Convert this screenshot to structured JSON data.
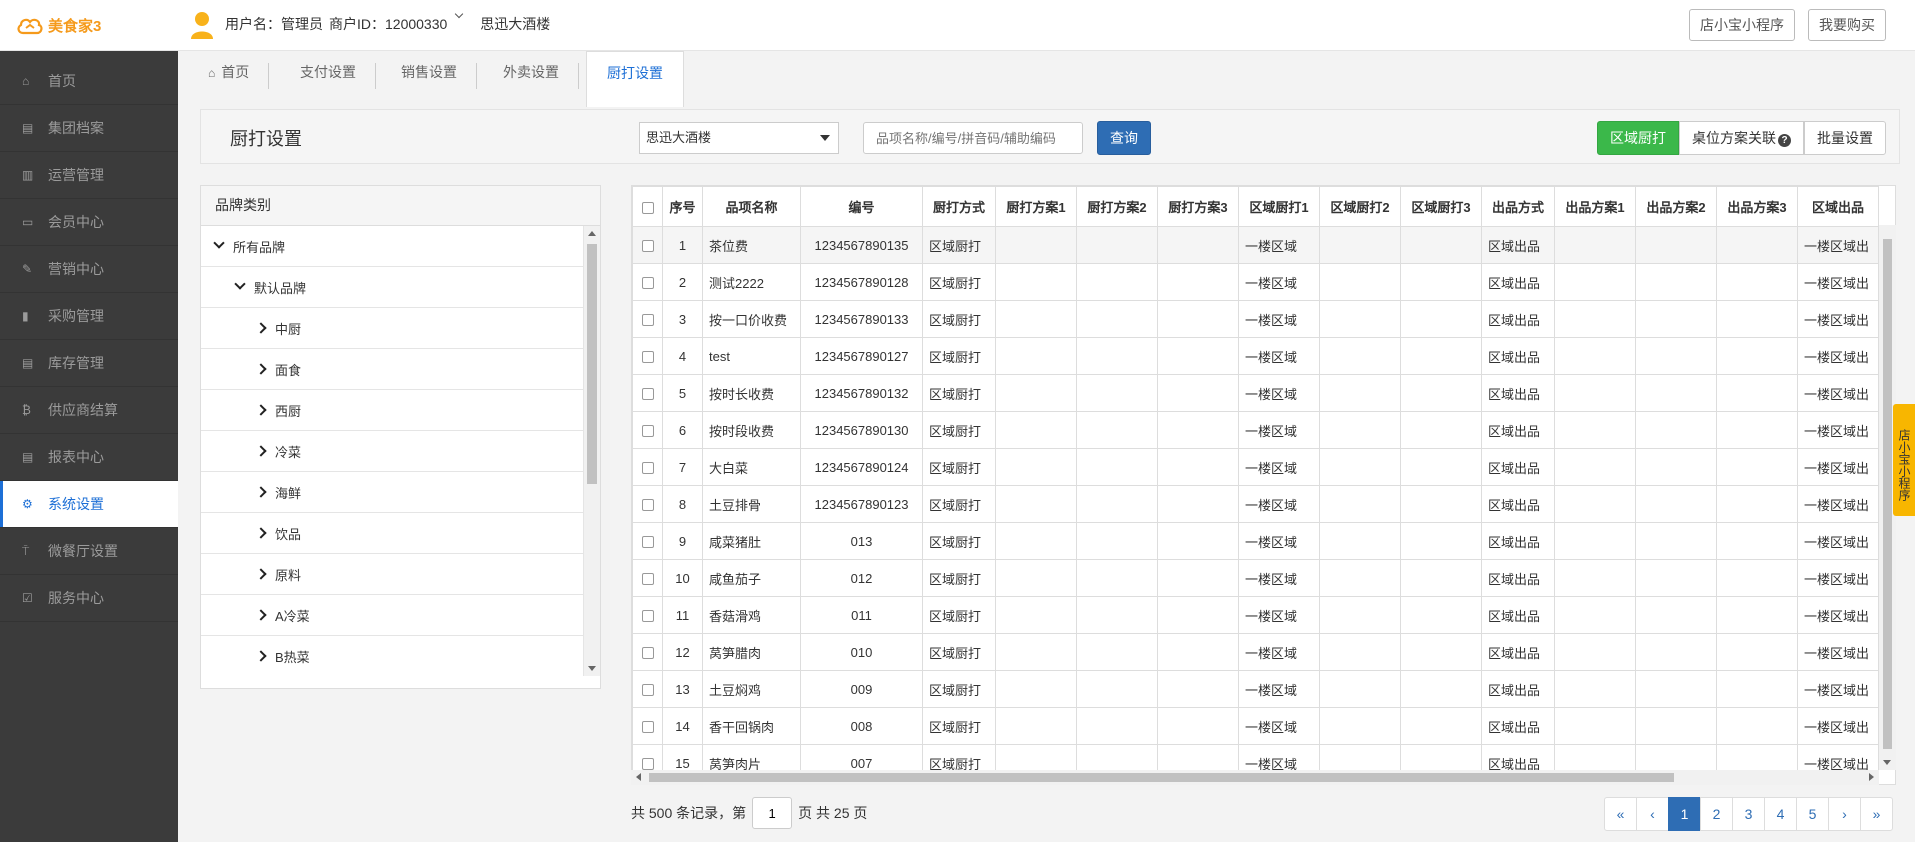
{
  "app": {
    "logo_text": "美食家3",
    "brand_color": "#f59a1b"
  },
  "header": {
    "user_label": "用户名：管理员",
    "merchant_label": "商户ID：12000330",
    "store_name": "思迅大酒楼",
    "btn_mini": "店小宝小程序",
    "btn_buy": "我要购买"
  },
  "sidebar": {
    "items": [
      {
        "label": "首页",
        "icon": "home-icon"
      },
      {
        "label": "集团档案",
        "icon": "file-icon"
      },
      {
        "label": "运营管理",
        "icon": "bar-chart-icon"
      },
      {
        "label": "会员中心",
        "icon": "id-card-icon"
      },
      {
        "label": "营销中心",
        "icon": "edit-icon"
      },
      {
        "label": "采购管理",
        "icon": "book-icon"
      },
      {
        "label": "库存管理",
        "icon": "file-icon"
      },
      {
        "label": "供应商结算",
        "icon": "bitcoin-icon"
      },
      {
        "label": "报表中心",
        "icon": "report-icon"
      },
      {
        "label": "系统设置",
        "icon": "gears-icon",
        "active": true
      },
      {
        "label": "微餐厅设置",
        "icon": "cutlery-icon"
      },
      {
        "label": "服务中心",
        "icon": "check-square-icon"
      }
    ]
  },
  "tabs": [
    {
      "label": "首页"
    },
    {
      "label": "支付设置"
    },
    {
      "label": "销售设置"
    },
    {
      "label": "外卖设置"
    },
    {
      "label": "厨打设置",
      "active": true
    }
  ],
  "toolbar": {
    "title": "厨打设置",
    "store_select": "思迅大酒楼",
    "search_placeholder": "品项名称/编号/拼音码/辅助编码",
    "query_btn": "查询",
    "btn_area_print": "区域厨打",
    "btn_table_plan": "桌位方案关联",
    "btn_batch": "批量设置"
  },
  "tree": {
    "header": "品牌类别",
    "nodes": [
      {
        "label": "所有品牌",
        "level": 0,
        "expanded": true
      },
      {
        "label": "默认品牌",
        "level": 1,
        "expanded": true
      },
      {
        "label": "中厨",
        "level": 2
      },
      {
        "label": "面食",
        "level": 2
      },
      {
        "label": "西厨",
        "level": 2
      },
      {
        "label": "冷菜",
        "level": 2
      },
      {
        "label": "海鲜",
        "level": 2
      },
      {
        "label": "饮品",
        "level": 2
      },
      {
        "label": "原料",
        "level": 2
      },
      {
        "label": "A冷菜",
        "level": 2
      },
      {
        "label": "B热菜",
        "level": 2
      }
    ]
  },
  "table": {
    "columns": [
      "序号",
      "品项名称",
      "编号",
      "厨打方式",
      "厨打方案1",
      "厨打方案2",
      "厨打方案3",
      "区域厨打1",
      "区域厨打2",
      "区域厨打3",
      "出品方式",
      "出品方案1",
      "出品方案2",
      "出品方案3",
      "区域出品"
    ],
    "rows": [
      {
        "no": "1",
        "name": "茶位费",
        "code": "1234567890135",
        "print": "区域厨打",
        "area1": "一楼区域",
        "out": "区域出品",
        "area_out": "一楼区域出"
      },
      {
        "no": "2",
        "name": "测试2222",
        "code": "1234567890128",
        "print": "区域厨打",
        "area1": "一楼区域",
        "out": "区域出品",
        "area_out": "一楼区域出"
      },
      {
        "no": "3",
        "name": "按一口价收费",
        "code": "1234567890133",
        "print": "区域厨打",
        "area1": "一楼区域",
        "out": "区域出品",
        "area_out": "一楼区域出"
      },
      {
        "no": "4",
        "name": "test",
        "code": "1234567890127",
        "print": "区域厨打",
        "area1": "一楼区域",
        "out": "区域出品",
        "area_out": "一楼区域出"
      },
      {
        "no": "5",
        "name": "按时长收费",
        "code": "1234567890132",
        "print": "区域厨打",
        "area1": "一楼区域",
        "out": "区域出品",
        "area_out": "一楼区域出"
      },
      {
        "no": "6",
        "name": "按时段收费",
        "code": "1234567890130",
        "print": "区域厨打",
        "area1": "一楼区域",
        "out": "区域出品",
        "area_out": "一楼区域出"
      },
      {
        "no": "7",
        "name": "大白菜",
        "code": "1234567890124",
        "print": "区域厨打",
        "area1": "一楼区域",
        "out": "区域出品",
        "area_out": "一楼区域出"
      },
      {
        "no": "8",
        "name": "土豆排骨",
        "code": "1234567890123",
        "print": "区域厨打",
        "area1": "一楼区域",
        "out": "区域出品",
        "area_out": "一楼区域出"
      },
      {
        "no": "9",
        "name": "咸菜猪肚",
        "code": "013",
        "print": "区域厨打",
        "area1": "一楼区域",
        "out": "区域出品",
        "area_out": "一楼区域出"
      },
      {
        "no": "10",
        "name": "咸鱼茄子",
        "code": "012",
        "print": "区域厨打",
        "area1": "一楼区域",
        "out": "区域出品",
        "area_out": "一楼区域出"
      },
      {
        "no": "11",
        "name": "香菇滑鸡",
        "code": "011",
        "print": "区域厨打",
        "area1": "一楼区域",
        "out": "区域出品",
        "area_out": "一楼区域出"
      },
      {
        "no": "12",
        "name": "莴笋腊肉",
        "code": "010",
        "print": "区域厨打",
        "area1": "一楼区域",
        "out": "区域出品",
        "area_out": "一楼区域出"
      },
      {
        "no": "13",
        "name": "土豆焖鸡",
        "code": "009",
        "print": "区域厨打",
        "area1": "一楼区域",
        "out": "区域出品",
        "area_out": "一楼区域出"
      },
      {
        "no": "14",
        "name": "香干回锅肉",
        "code": "008",
        "print": "区域厨打",
        "area1": "一楼区域",
        "out": "区域出品",
        "area_out": "一楼区域出"
      },
      {
        "no": "15",
        "name": "莴笋肉片",
        "code": "007",
        "print": "区域厨打",
        "area1": "一楼区域",
        "out": "区域出品",
        "area_out": "一楼区域出"
      }
    ]
  },
  "pager": {
    "prefix": "共 500 条记录，第",
    "current_input": "1",
    "suffix": "页 共 25 页",
    "buttons": [
      "«",
      "‹",
      "1",
      "2",
      "3",
      "4",
      "5",
      "›",
      "»"
    ],
    "active": "1"
  },
  "float_tab": "店小宝小程序"
}
